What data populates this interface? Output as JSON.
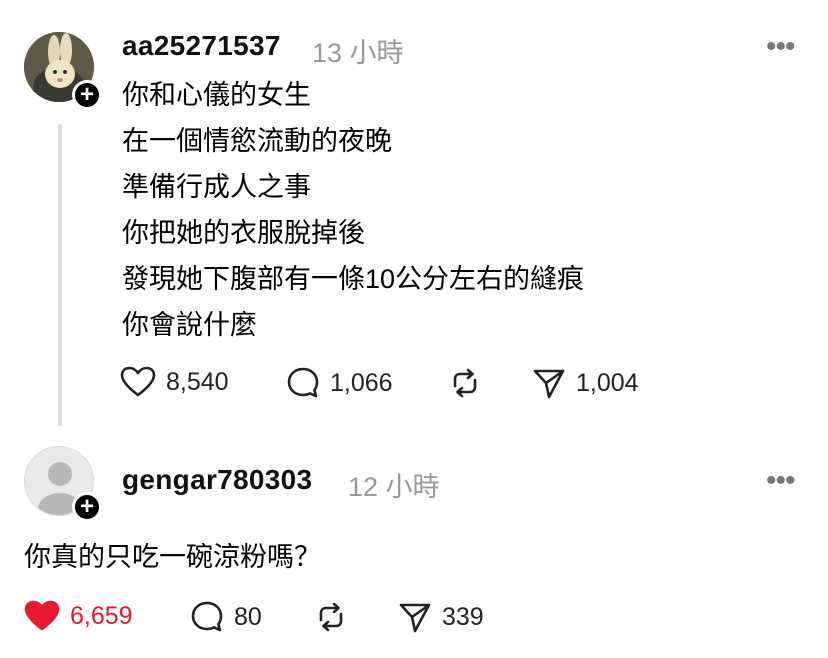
{
  "post": {
    "username": "aa25271537",
    "time": "13 小時",
    "more_label": "•••",
    "lines": [
      "你和心儀的女生",
      "在一個情慾流動的夜晚",
      "準備行成人之事",
      "你把她的衣服脫掉後",
      "發現她下腹部有一條10公分左右的縫痕",
      "你會說什麼"
    ],
    "likes": "8,540",
    "comments": "1,066",
    "shares": "1,004"
  },
  "reply": {
    "username": "gengar780303",
    "time": "12 小時",
    "more_label": "•••",
    "text": "你真的只吃一碗涼粉嗎？",
    "likes": "6,659",
    "comments": "80",
    "shares": "339",
    "liked": true
  },
  "colors": {
    "like_red": "#e8192c",
    "muted": "#999999",
    "thread_line": "#dcdcdc"
  },
  "icons": [
    "heart-icon",
    "comment-icon",
    "repost-icon",
    "send-icon",
    "plus-icon",
    "more-icon"
  ]
}
